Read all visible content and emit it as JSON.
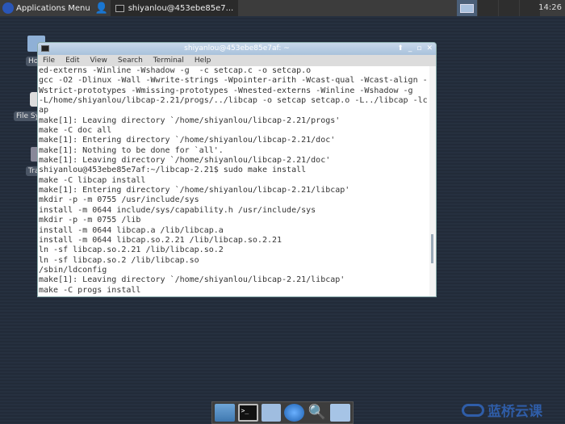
{
  "panel": {
    "app_menu": "Applications Menu",
    "task": "shiyanlou@453ebe85e7...",
    "clock": "14:26",
    "workspaces": 4,
    "active_workspace": 1
  },
  "desktop": {
    "icons": [
      {
        "label": "Home",
        "icon": "home-folder-icon"
      },
      {
        "label": "File System",
        "icon": "drive-icon"
      },
      {
        "label": "Trash",
        "icon": "trash-icon"
      }
    ]
  },
  "terminal": {
    "title": "shiyanlou@453ebe85e7af: ~",
    "menu": [
      "File",
      "Edit",
      "View",
      "Search",
      "Terminal",
      "Help"
    ],
    "lines": [
      "ed-externs -Winline -Wshadow -g  -c setcap.c -o setcap.o",
      "gcc -O2 -Dlinux -Wall -Wwrite-strings -Wpointer-arith -Wcast-qual -Wcast-align -",
      "Wstrict-prototypes -Wmissing-prototypes -Wnested-externs -Winline -Wshadow -g",
      "-L/home/shiyanlou/libcap-2.21/progs/../libcap -o setcap setcap.o -L../libcap -lc",
      "ap",
      "make[1]: Leaving directory `/home/shiyanlou/libcap-2.21/progs'",
      "make -C doc all",
      "make[1]: Entering directory `/home/shiyanlou/libcap-2.21/doc'",
      "make[1]: Nothing to be done for `all'.",
      "make[1]: Leaving directory `/home/shiyanlou/libcap-2.21/doc'",
      "shiyanlou@453ebe85e7af:~/libcap-2.21$ sudo make install",
      "make -C libcap install",
      "make[1]: Entering directory `/home/shiyanlou/libcap-2.21/libcap'",
      "mkdir -p -m 0755 /usr/include/sys",
      "install -m 0644 include/sys/capability.h /usr/include/sys",
      "mkdir -p -m 0755 /lib",
      "install -m 0644 libcap.a /lib/libcap.a",
      "install -m 0644 libcap.so.2.21 /lib/libcap.so.2.21",
      "ln -sf libcap.so.2.21 /lib/libcap.so.2",
      "ln -sf libcap.so.2 /lib/libcap.so",
      "/sbin/ldconfig",
      "make[1]: Leaving directory `/home/shiyanlou/libcap-2.21/libcap'",
      "make -C progs install"
    ]
  },
  "dock": [
    "show-desktop-icon",
    "terminal-icon",
    "file-manager-icon",
    "web-browser-icon",
    "search-icon",
    "folder-icon"
  ],
  "watermark": "蓝桥云课"
}
